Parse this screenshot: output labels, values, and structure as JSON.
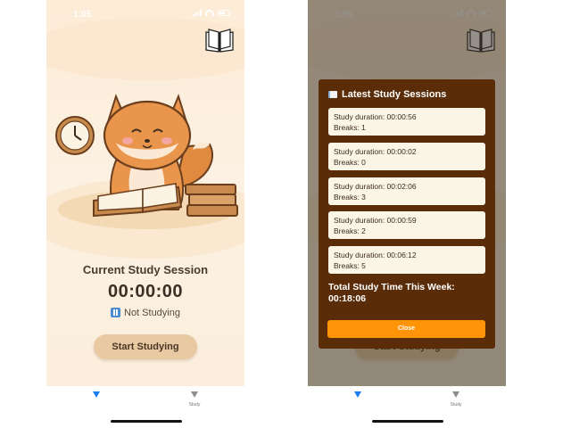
{
  "status_bar": {
    "time": "1:05"
  },
  "main": {
    "session_title": "Current Study Session",
    "timer": "00:00:00",
    "status_text": "Not Studying",
    "start_button": "Start Studying"
  },
  "tab_bar": {
    "tab_right_label": "Study"
  },
  "modal": {
    "title": "Latest Study Sessions",
    "sessions": [
      {
        "duration": "Study duration: 00:00:56",
        "breaks": "Breaks: 1"
      },
      {
        "duration": "Study duration: 00:00:02",
        "breaks": "Breaks: 0"
      },
      {
        "duration": "Study duration: 00:02:06",
        "breaks": "Breaks: 3"
      },
      {
        "duration": "Study duration: 00:00:59",
        "breaks": "Breaks: 2"
      },
      {
        "duration": "Study duration: 00:06:12",
        "breaks": "Breaks: 5"
      }
    ],
    "total_label": "Total Study Time This Week:",
    "total_value": "00:18:06",
    "close_button": "Close"
  },
  "colors": {
    "accent_tab": "#1c7cf2",
    "modal_bg": "#5a2c08",
    "close_button": "#ff9408",
    "start_button": "#e8c9a2"
  }
}
